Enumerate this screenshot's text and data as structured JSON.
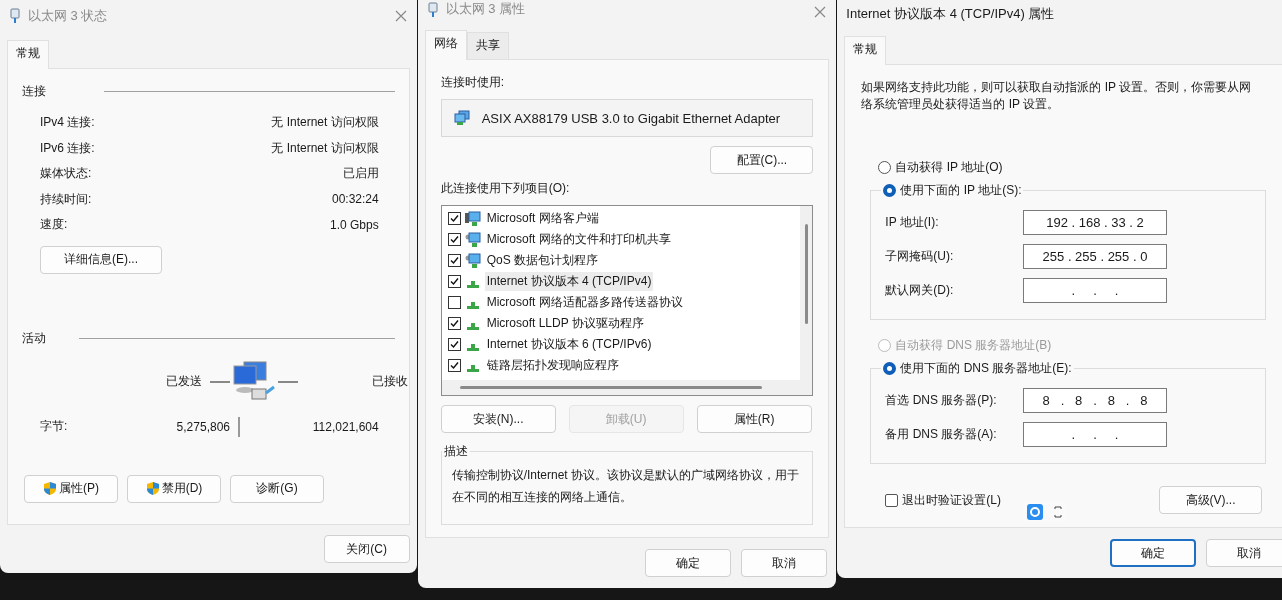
{
  "status_window": {
    "title": "以太网 3 状态",
    "tabs": [
      {
        "label": "常规",
        "selected": true
      }
    ],
    "connection": {
      "heading": "连接",
      "rows": [
        {
          "label": "IPv4 连接:",
          "value": "无 Internet 访问权限"
        },
        {
          "label": "IPv6 连接:",
          "value": "无 Internet 访问权限"
        },
        {
          "label": "媒体状态:",
          "value": "已启用"
        },
        {
          "label": "持续时间:",
          "value": "00:32:24"
        },
        {
          "label": "速度:",
          "value": "1.0 Gbps"
        }
      ]
    },
    "details_button": "详细信息(E)...",
    "activity": {
      "heading": "活动",
      "sent_label": "已发送",
      "received_label": "已接收",
      "bytes_label": "字节:",
      "bytes_sent": "5,275,806",
      "bytes_received": "112,021,604"
    },
    "buttons": [
      {
        "label": "属性(P)",
        "shield": true
      },
      {
        "label": "禁用(D)",
        "shield": true
      },
      {
        "label": "诊断(G)",
        "shield": false
      }
    ],
    "close_button": "关闭(C)"
  },
  "properties_window": {
    "title": "以太网 3 属性",
    "tabs": [
      {
        "label": "网络",
        "selected": true
      },
      {
        "label": "共享",
        "selected": false
      }
    ],
    "connect_using_label": "连接时使用:",
    "adapter": "ASIX AX88179 USB 3.0 to Gigabit Ethernet Adapter",
    "configure_button": "配置(C)...",
    "items_label": "此连接使用下列项目(O):",
    "items": [
      {
        "label": "Microsoft 网络客户端",
        "checked": true,
        "selected": false,
        "kind": "client"
      },
      {
        "label": "Microsoft 网络的文件和打印机共享",
        "checked": true,
        "selected": false,
        "kind": "service"
      },
      {
        "label": "QoS 数据包计划程序",
        "checked": true,
        "selected": false,
        "kind": "service"
      },
      {
        "label": "Internet 协议版本 4 (TCP/IPv4)",
        "checked": true,
        "selected": true,
        "kind": "protocol"
      },
      {
        "label": "Microsoft 网络适配器多路传送器协议",
        "checked": false,
        "selected": false,
        "kind": "protocol"
      },
      {
        "label": "Microsoft LLDP 协议驱动程序",
        "checked": true,
        "selected": false,
        "kind": "protocol"
      },
      {
        "label": "Internet 协议版本 6 (TCP/IPv6)",
        "checked": true,
        "selected": false,
        "kind": "protocol"
      },
      {
        "label": "链路层拓扑发现响应程序",
        "checked": true,
        "selected": false,
        "kind": "protocol"
      }
    ],
    "item_buttons": [
      {
        "label": "安装(N)...",
        "disabled": false
      },
      {
        "label": "卸载(U)",
        "disabled": true
      },
      {
        "label": "属性(R)",
        "disabled": false
      }
    ],
    "description": {
      "heading": "描述",
      "text": "传输控制协议/Internet 协议。该协议是默认的广域网络协议，用于在不同的相互连接的网络上通信。"
    },
    "footer_buttons": [
      {
        "label": "确定",
        "default": false
      },
      {
        "label": "取消",
        "default": false
      }
    ]
  },
  "ipv4_window": {
    "title": "Internet 协议版本 4 (TCP/IPv4) 属性",
    "tabs": [
      {
        "label": "常规",
        "selected": true
      }
    ],
    "intro": "如果网络支持此功能，则可以获取自动指派的 IP 设置。否则，你需要从网络系统管理员处获得适当的 IP 设置。",
    "ip_auto": {
      "label": "自动获得 IP 地址(O)",
      "selected": false,
      "disabled": false
    },
    "ip_manual": {
      "label": "使用下面的 IP 地址(S):",
      "selected": true,
      "disabled": false
    },
    "ip_fields": [
      {
        "label": "IP 地址(I):",
        "value": "192 . 168 . 33 . 2"
      },
      {
        "label": "子网掩码(U):",
        "value": "255 . 255 . 255 . 0"
      },
      {
        "label": "默认网关(D):",
        "value": ".     .     ."
      }
    ],
    "dns_auto": {
      "label": "自动获得 DNS 服务器地址(B)",
      "selected": false,
      "disabled": true
    },
    "dns_manual": {
      "label": "使用下面的 DNS 服务器地址(E):",
      "selected": true,
      "disabled": false
    },
    "dns_fields": [
      {
        "label": "首选 DNS 服务器(P):",
        "value": "8   .   8   .   8   .   8"
      },
      {
        "label": "备用 DNS 服务器(A):",
        "value": ".     .     ."
      }
    ],
    "validate": {
      "label": "退出时验证设置(L)",
      "checked": false
    },
    "advanced_button": "高级(V)...",
    "footer_buttons": [
      {
        "label": "确定",
        "default": true
      },
      {
        "label": "取消",
        "default": false
      }
    ]
  }
}
